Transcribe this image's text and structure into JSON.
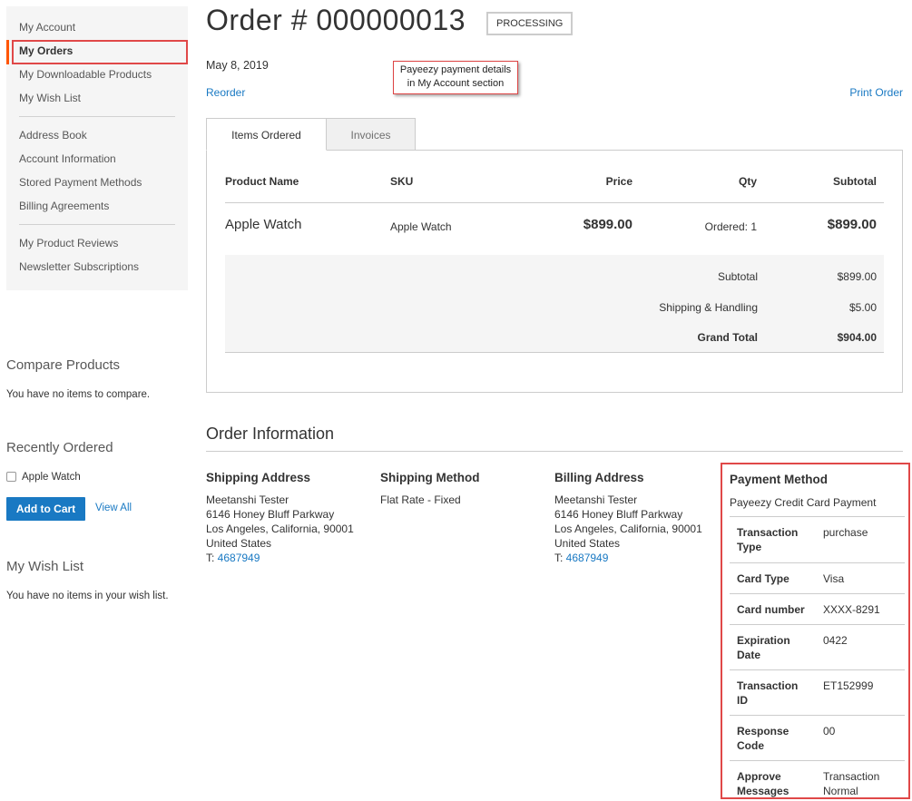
{
  "sidebar": {
    "groups": [
      [
        "My Account",
        "My Orders",
        "My Downloadable Products",
        "My Wish List"
      ],
      [
        "Address Book",
        "Account Information",
        "Stored Payment Methods",
        "Billing Agreements"
      ],
      [
        "My Product Reviews",
        "Newsletter Subscriptions"
      ]
    ],
    "active": "My Orders"
  },
  "compare": {
    "title": "Compare Products",
    "empty_text": "You have no items to compare."
  },
  "recently_ordered": {
    "title": "Recently Ordered",
    "item": "Apple Watch",
    "add_to_cart": "Add to Cart",
    "view_all": "View All"
  },
  "wishlist": {
    "title": "My Wish List",
    "empty_text": "You have no items in your wish list."
  },
  "order": {
    "title": "Order # 000000013",
    "status": "PROCESSING",
    "date": "May 8, 2019",
    "reorder": "Reorder",
    "print": "Print Order"
  },
  "callout": {
    "line1": "Payeezy payment details",
    "line2": "in My Account section"
  },
  "tabs": {
    "items_ordered": "Items Ordered",
    "invoices": "Invoices"
  },
  "items_table": {
    "headers": {
      "product": "Product Name",
      "sku": "SKU",
      "price": "Price",
      "qty": "Qty",
      "subtotal": "Subtotal"
    },
    "row": {
      "name": "Apple Watch",
      "sku": "Apple Watch",
      "price": "$899.00",
      "qty": "Ordered: 1",
      "subtotal": "$899.00"
    },
    "totals": [
      {
        "label": "Subtotal",
        "value": "$899.00"
      },
      {
        "label": "Shipping & Handling",
        "value": "$5.00"
      },
      {
        "label": "Grand Total",
        "value": "$904.00"
      }
    ]
  },
  "order_info": {
    "title": "Order Information",
    "shipping_address": {
      "title": "Shipping Address",
      "lines": [
        "Meetanshi Tester",
        "6146 Honey Bluff Parkway",
        "Los Angeles, California, 90001",
        "United States"
      ],
      "phone_prefix": "T: ",
      "phone": "4687949"
    },
    "shipping_method": {
      "title": "Shipping Method",
      "value": "Flat Rate - Fixed"
    },
    "billing_address": {
      "title": "Billing Address",
      "lines": [
        "Meetanshi Tester",
        "6146 Honey Bluff Parkway",
        "Los Angeles, California, 90001",
        "United States"
      ],
      "phone_prefix": "T: ",
      "phone": "4687949"
    },
    "payment_method": {
      "title": "Payment Method",
      "desc": "Payeezy Credit Card Payment",
      "rows": [
        {
          "key": "Transaction Type",
          "value": "purchase"
        },
        {
          "key": "Card Type",
          "value": "Visa"
        },
        {
          "key": "Card number",
          "value": "XXXX-8291"
        },
        {
          "key": "Expiration Date",
          "value": "0422"
        },
        {
          "key": "Transaction ID",
          "value": "ET152999"
        },
        {
          "key": "Response Code",
          "value": "00"
        },
        {
          "key": "Approve Messages",
          "value": "Transaction Normal"
        }
      ]
    }
  },
  "colors": {
    "link": "#1979c3",
    "highlight": "#e04848",
    "active_marker": "#ff5501",
    "button": "#1979c3"
  }
}
